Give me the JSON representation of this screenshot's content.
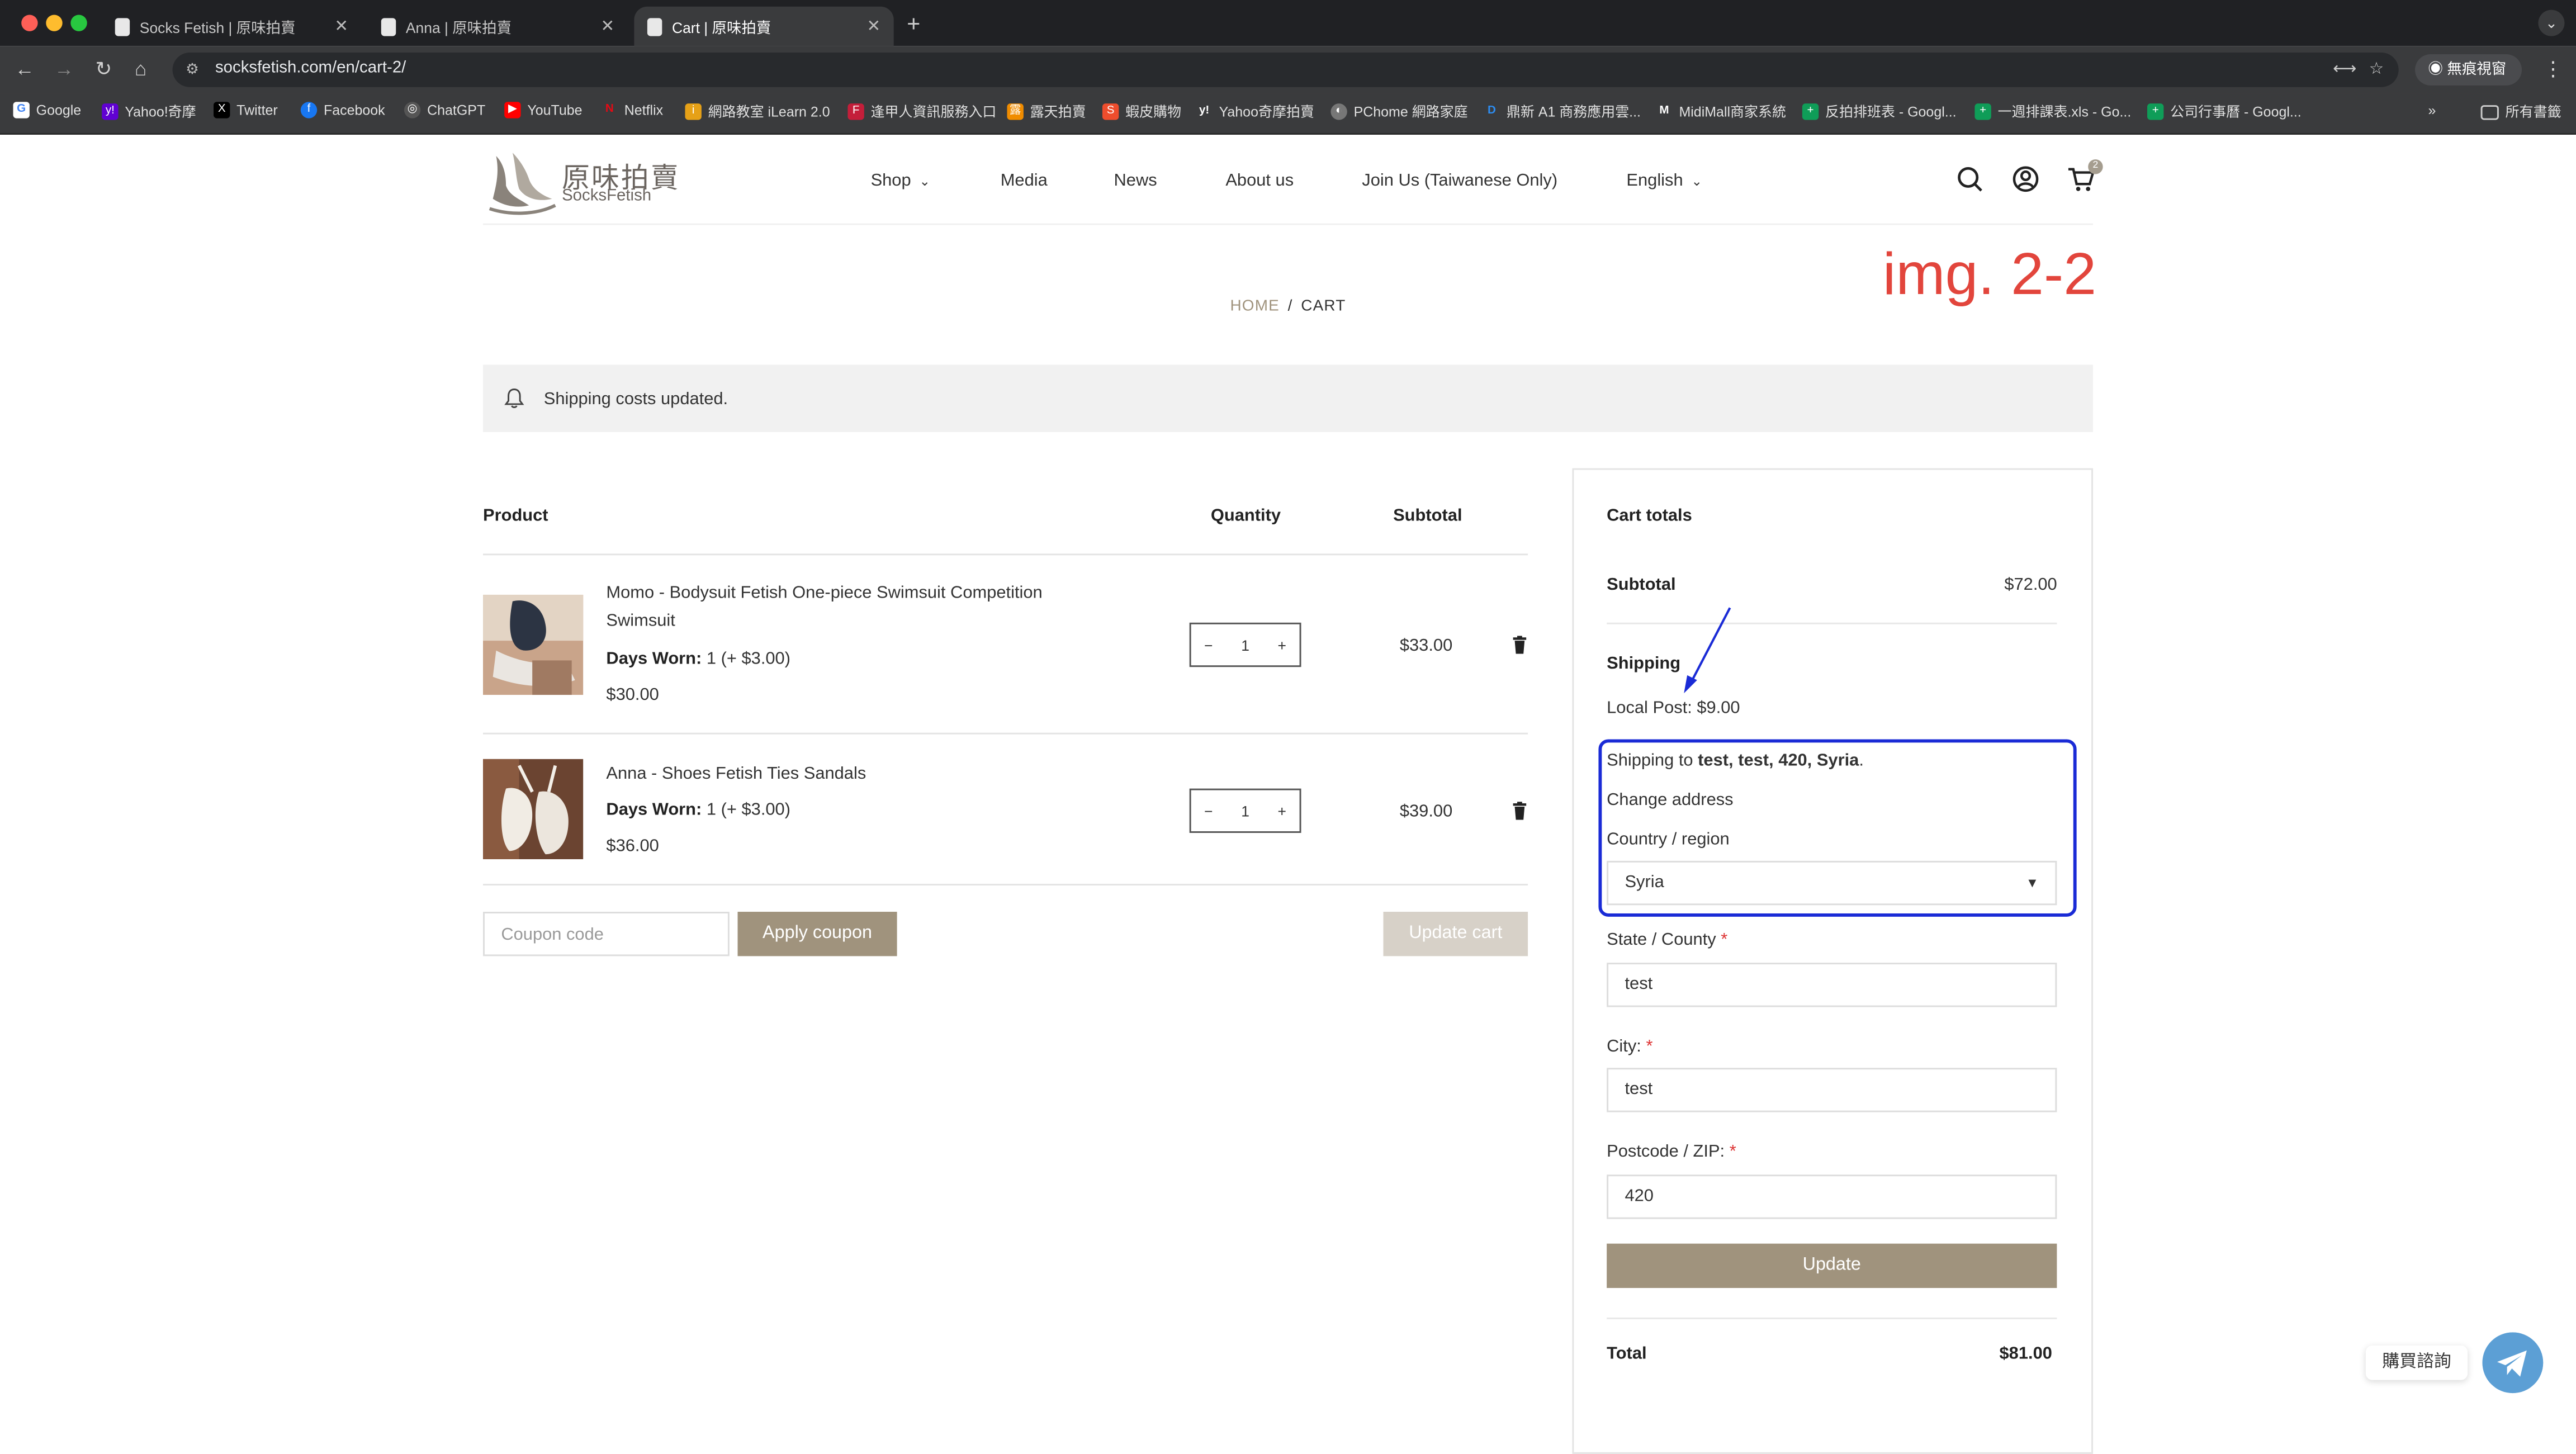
{
  "browser": {
    "tabs": [
      {
        "title": "Socks Fetish | 原味拍賣",
        "active": false
      },
      {
        "title": "Anna | 原味拍賣",
        "active": false
      },
      {
        "title": "Cart | 原味拍賣",
        "active": true
      }
    ],
    "new_tab": "+",
    "url": "socksfetish.com/en/cart-2/",
    "incognito_label": "無痕視窗",
    "bookmarks": [
      {
        "label": "Google",
        "icon": "google-icon",
        "color": "#4285f4"
      },
      {
        "label": "Yahoo!奇摩",
        "icon": "yahoo-icon",
        "color": "#6001d2"
      },
      {
        "label": "Twitter",
        "icon": "x-icon",
        "color": "#000000"
      },
      {
        "label": "Facebook",
        "icon": "facebook-icon",
        "color": "#1877f2"
      },
      {
        "label": "ChatGPT",
        "icon": "chatgpt-icon",
        "color": "#666666"
      },
      {
        "label": "YouTube",
        "icon": "youtube-icon",
        "color": "#ff0000"
      },
      {
        "label": "Netflix",
        "icon": "netflix-icon",
        "color": "#e50914"
      },
      {
        "label": "網路教室 iLearn 2.0",
        "icon": "ilearn-icon",
        "color": "#e6a117"
      },
      {
        "label": "逢甲人資訊服務入口",
        "icon": "fcu-icon",
        "color": "#c41e3a"
      },
      {
        "label": "露天拍賣",
        "icon": "ruten-icon",
        "color": "#f08c00"
      },
      {
        "label": "蝦皮購物",
        "icon": "shopee-icon",
        "color": "#ee4d2d"
      },
      {
        "label": "Yahoo奇摩拍賣",
        "icon": "yahoo-auction-icon",
        "color": "#ffffff"
      },
      {
        "label": "PChome 網路家庭",
        "icon": "pchome-icon",
        "color": "#888888"
      },
      {
        "label": "鼎新 A1 商務應用雲...",
        "icon": "digiwin-icon",
        "color": "#2d8cf0"
      },
      {
        "label": "MidiMall商家系統",
        "icon": "midimall-icon",
        "color": "#ffffff"
      },
      {
        "label": "反拍排班表 - Googl...",
        "icon": "sheets-icon",
        "color": "#0f9d58"
      },
      {
        "label": "一週排課表.xls - Go...",
        "icon": "sheets-icon",
        "color": "#0f9d58"
      },
      {
        "label": "公司行事曆 - Googl...",
        "icon": "sheets-icon",
        "color": "#0f9d58"
      }
    ],
    "all_bookmarks": "所有書籤"
  },
  "site": {
    "logo_cn": "原味拍賣",
    "logo_en": "SocksFetish",
    "nav": [
      {
        "label": "Shop",
        "dropdown": true
      },
      {
        "label": "Media",
        "dropdown": false
      },
      {
        "label": "News",
        "dropdown": false
      },
      {
        "label": "About us",
        "dropdown": false
      },
      {
        "label": "Join Us (Taiwanese Only)",
        "dropdown": false
      },
      {
        "label": "English",
        "dropdown": true
      }
    ],
    "cart_count": "2"
  },
  "annotation": "img. 2-2",
  "breadcrumb": {
    "home": "HOME",
    "sep": "/",
    "current": "CART"
  },
  "notice": "Shipping costs updated.",
  "cart": {
    "headers": {
      "product": "Product",
      "quantity": "Quantity",
      "subtotal": "Subtotal"
    },
    "items": [
      {
        "name": "Momo - Bodysuit Fetish One-piece Swimsuit Competition Swimsuit",
        "meta_label": "Days Worn:",
        "meta_value": " 1 (+ $3.00)",
        "price": "$30.00",
        "qty": "1",
        "subtotal": "$33.00"
      },
      {
        "name": "Anna - Shoes Fetish Ties Sandals",
        "meta_label": "Days Worn:",
        "meta_value": " 1 (+ $3.00)",
        "price": "$36.00",
        "qty": "1",
        "subtotal": "$39.00"
      }
    ],
    "coupon_placeholder": "Coupon code",
    "apply_coupon": "Apply coupon",
    "update_cart": "Update cart"
  },
  "totals": {
    "title": "Cart totals",
    "subtotal_label": "Subtotal",
    "subtotal_value": "$72.00",
    "shipping_label": "Shipping",
    "shipping_method": "Local Post: $9.00",
    "shipping_to_prefix": "Shipping to ",
    "shipping_to_address": "test, test, 420, Syria",
    "shipping_to_suffix": ".",
    "change_address": "Change address",
    "country_label": "Country / region",
    "country_value": "Syria",
    "state_label": "State / County",
    "state_value": "test",
    "city_label": "City:",
    "city_value": "test",
    "zip_label": "Postcode / ZIP:",
    "zip_value": "420",
    "required_mark": "*",
    "update_label": "Update",
    "total_label": "Total",
    "total_value": "$81.00"
  },
  "chat": {
    "label": "購買諮詢"
  },
  "colors": {
    "accent": "#a0937d",
    "annotation": "#e2453c",
    "highlight": "#1a2bd6"
  }
}
